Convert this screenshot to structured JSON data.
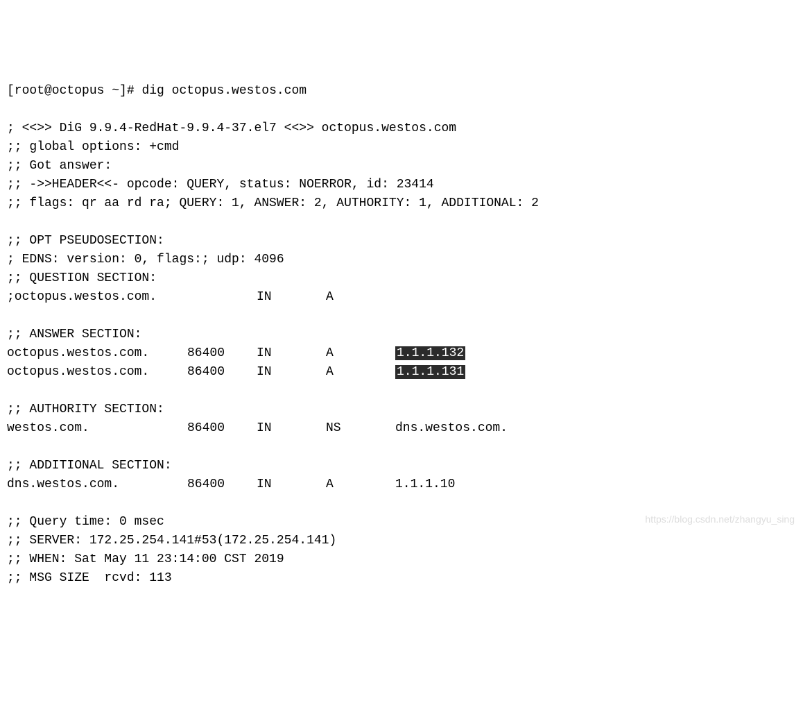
{
  "prompt": "[root@octopus ~]# ",
  "command": "dig octopus.westos.com",
  "blank": "",
  "banner": "; <<>> DiG 9.9.4-RedHat-9.9.4-37.el7 <<>> octopus.westos.com",
  "global_options": ";; global options: +cmd",
  "got_answer": ";; Got answer:",
  "header": ";; ->>HEADER<<- opcode: QUERY, status: NOERROR, id: 23414",
  "flags": ";; flags: qr aa rd ra; QUERY: 1, ANSWER: 2, AUTHORITY: 1, ADDITIONAL: 2",
  "opt_header": ";; OPT PSEUDOSECTION:",
  "edns": "; EDNS: version: 0, flags:; udp: 4096",
  "question_header": ";; QUESTION SECTION:",
  "question_name": ";octopus.westos.com.",
  "question_class": "IN",
  "question_type": "A",
  "answer_header": ";; ANSWER SECTION:",
  "answer1_name": "octopus.westos.com.",
  "answer1_ttl": "86400",
  "answer1_class": "IN",
  "answer1_type": "A",
  "answer1_data": "1.1.1.132",
  "answer2_name": "octopus.westos.com.",
  "answer2_ttl": "86400",
  "answer2_class": "IN",
  "answer2_type": "A",
  "answer2_data": "1.1.1.131",
  "authority_header": ";; AUTHORITY SECTION:",
  "authority_name": "westos.com.",
  "authority_ttl": "86400",
  "authority_class": "IN",
  "authority_type": "NS",
  "authority_data": "dns.westos.com.",
  "additional_header": ";; ADDITIONAL SECTION:",
  "additional_name": "dns.westos.com.",
  "additional_ttl": "86400",
  "additional_class": "IN",
  "additional_type": "A",
  "additional_data": "1.1.1.10",
  "query_time": ";; Query time: 0 msec",
  "server": ";; SERVER: 172.25.254.141#53(172.25.254.141)",
  "when": ";; WHEN: Sat May 11 23:14:00 CST 2019",
  "msg_size": ";; MSG SIZE  rcvd: 113",
  "watermark": "https://blog.csdn.net/zhangyu_sing"
}
